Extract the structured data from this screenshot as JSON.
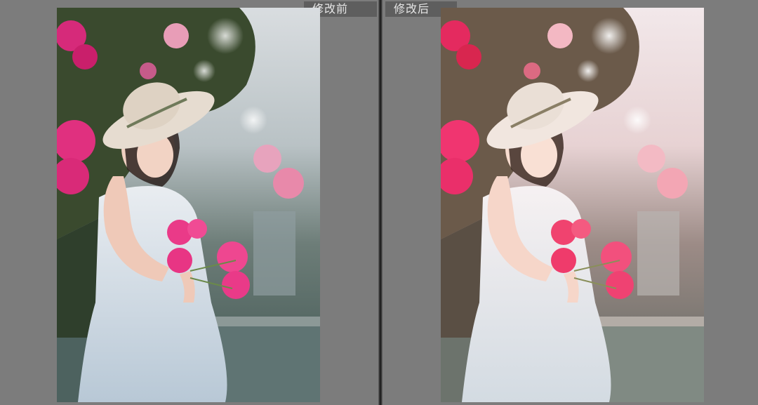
{
  "before": {
    "label": "修改前",
    "photo": "before-photo"
  },
  "after": {
    "label": "修改后",
    "photo": "after-photo"
  },
  "colors": {
    "background": "#7d7d7d",
    "tag_background": "#5e5e5e",
    "tag_text": "#e6e6e6"
  }
}
